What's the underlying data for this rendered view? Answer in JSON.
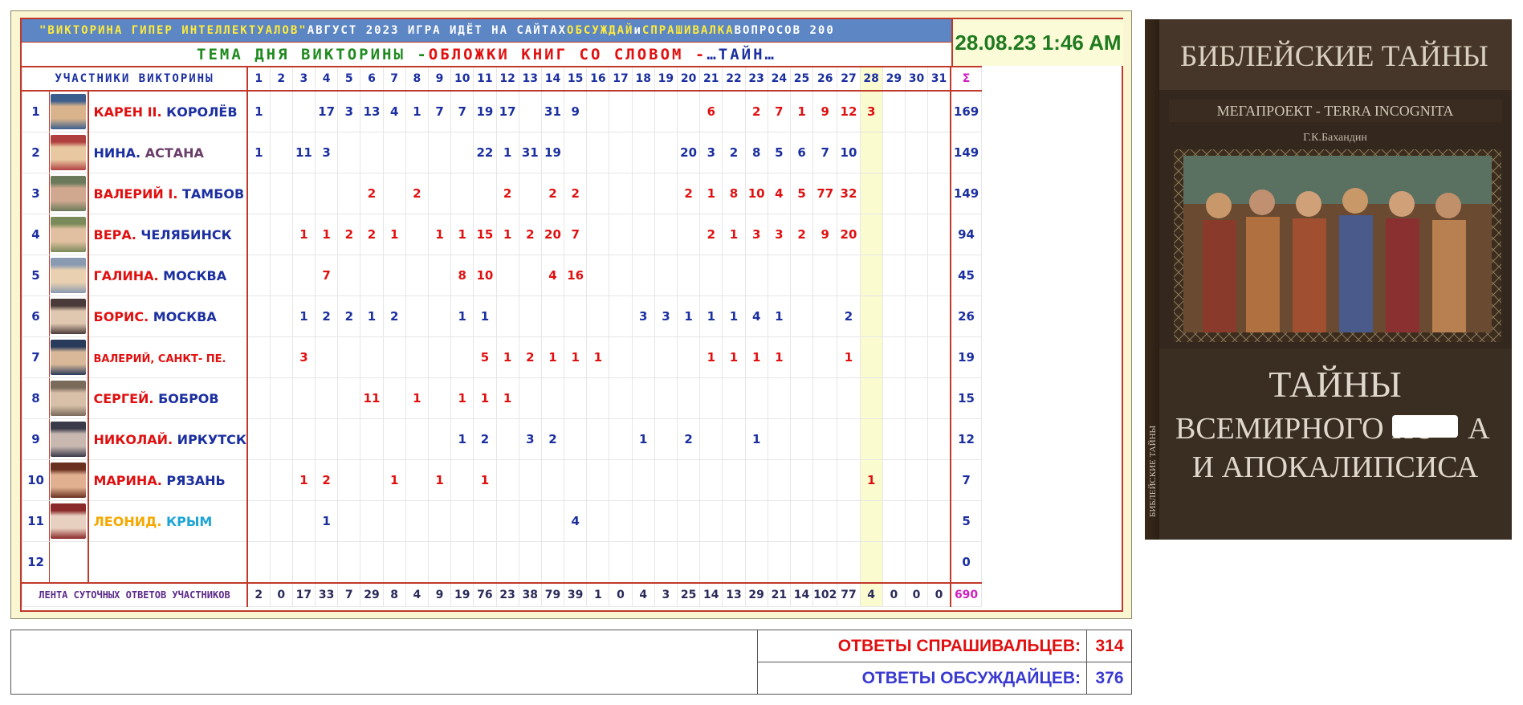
{
  "header": {
    "banner": [
      {
        "text": "\"ВИКТОРИНА ГИПЕР ИНТЕЛЛЕКТУАЛОВ\"",
        "color": "#ffeb3b"
      },
      {
        "text": " АВГУСТ 2023 ИГРА ИДЁТ НА САЙТАХ ",
        "color": "#ffffff"
      },
      {
        "text": "ОБСУЖДАЙ",
        "color": "#ffeb3b"
      },
      {
        "text": " и ",
        "color": "#ffffff"
      },
      {
        "text": "СПРАШИВАЛКА",
        "color": "#ffeb3b"
      },
      {
        "text": " ВОПРОСОВ 200",
        "color": "#ffffff"
      }
    ],
    "theme": [
      {
        "text": "ТЕМА ДНЯ ВИКТОРИНЫ - ",
        "cls": "g"
      },
      {
        "text": "ОБЛОЖКИ КНИГ СО СЛОВОМ - ",
        "cls": "r"
      },
      {
        "text": "…ТАЙН…",
        "cls": "b"
      }
    ],
    "datetime": "28.08.23 1:46 AM"
  },
  "table": {
    "participants_title": "УЧАСТНИКИ ВИКТОРИНЫ",
    "days": [
      "1",
      "2",
      "3",
      "4",
      "5",
      "6",
      "7",
      "8",
      "9",
      "10",
      "11",
      "12",
      "13",
      "14",
      "15",
      "16",
      "17",
      "18",
      "19",
      "20",
      "21",
      "22",
      "23",
      "24",
      "25",
      "26",
      "27",
      "28",
      "29",
      "30",
      "31"
    ],
    "red_days": [
      "6",
      "13",
      "20",
      "27"
    ],
    "sum_symbol": "Σ",
    "rows": [
      {
        "num": "1",
        "name_parts": [
          {
            "t": "КАРЕН II.",
            "c": "nr"
          },
          {
            "t": " КОРОЛЁВ",
            "c": "nb"
          }
        ],
        "avatar": [
          "#3b5e8c",
          "#d9b38c"
        ],
        "cells": {
          "1": [
            "1",
            "b"
          ],
          "4": [
            "17",
            "b"
          ],
          "5": [
            "3",
            "b"
          ],
          "6": [
            "13",
            "b"
          ],
          "7": [
            "4",
            "b"
          ],
          "8": [
            "1",
            "b"
          ],
          "9": [
            "7",
            "b"
          ],
          "10": [
            "7",
            "b"
          ],
          "11": [
            "19",
            "b"
          ],
          "12": [
            "17",
            "b"
          ],
          "14": [
            "31",
            "b"
          ],
          "15": [
            "9",
            "b"
          ],
          "21": [
            "6",
            "r"
          ],
          "23": [
            "2",
            "r"
          ],
          "24": [
            "7",
            "r"
          ],
          "25": [
            "1",
            "r"
          ],
          "26": [
            "9",
            "r"
          ],
          "27": [
            "12",
            "r"
          ],
          "28": [
            "3",
            "r"
          ]
        },
        "sum": "169"
      },
      {
        "num": "2",
        "name_parts": [
          {
            "t": "НИНА.",
            "c": "nb"
          },
          {
            "t": " АСТАНА",
            "c": "nm"
          }
        ],
        "avatar": [
          "#b04040",
          "#e8c8a0"
        ],
        "cells": {
          "1": [
            "1",
            "b"
          ],
          "3": [
            "11",
            "b"
          ],
          "4": [
            "3",
            "b"
          ],
          "11": [
            "22",
            "b"
          ],
          "12": [
            "1",
            "b"
          ],
          "13": [
            "31",
            "b"
          ],
          "14": [
            "19",
            "b"
          ],
          "20": [
            "20",
            "b"
          ],
          "21": [
            "3",
            "b"
          ],
          "22": [
            "2",
            "b"
          ],
          "23": [
            "8",
            "b"
          ],
          "24": [
            "5",
            "b"
          ],
          "25": [
            "6",
            "b"
          ],
          "26": [
            "7",
            "b"
          ],
          "27": [
            "10",
            "b"
          ]
        },
        "sum": "149"
      },
      {
        "num": "3",
        "name_parts": [
          {
            "t": "ВАЛЕРИЙ I.",
            "c": "nr"
          },
          {
            "t": "  ТАМБОВ",
            "c": "nb"
          }
        ],
        "avatar": [
          "#6a7a5a",
          "#d0a890"
        ],
        "cells": {
          "6": [
            "2",
            "r"
          ],
          "8": [
            "2",
            "r"
          ],
          "12": [
            "2",
            "r"
          ],
          "14": [
            "2",
            "r"
          ],
          "15": [
            "2",
            "r"
          ],
          "20": [
            "2",
            "r"
          ],
          "21": [
            "1",
            "r"
          ],
          "22": [
            "8",
            "r"
          ],
          "23": [
            "10",
            "r"
          ],
          "24": [
            "4",
            "r"
          ],
          "25": [
            "5",
            "r"
          ],
          "26": [
            "77",
            "r"
          ],
          "27": [
            "32",
            "r"
          ]
        },
        "sum": "149"
      },
      {
        "num": "4",
        "name_parts": [
          {
            "t": "ВЕРА.",
            "c": "nr"
          },
          {
            "t": " ЧЕЛЯБИНСК",
            "c": "nb"
          }
        ],
        "avatar": [
          "#7a8a5a",
          "#e0c0a0"
        ],
        "cells": {
          "3": [
            "1",
            "r"
          ],
          "4": [
            "1",
            "r"
          ],
          "5": [
            "2",
            "r"
          ],
          "6": [
            "2",
            "r"
          ],
          "7": [
            "1",
            "r"
          ],
          "9": [
            "1",
            "r"
          ],
          "10": [
            "1",
            "r"
          ],
          "11": [
            "15",
            "r"
          ],
          "12": [
            "1",
            "r"
          ],
          "13": [
            "2",
            "r"
          ],
          "14": [
            "20",
            "r"
          ],
          "15": [
            "7",
            "r"
          ],
          "21": [
            "2",
            "r"
          ],
          "22": [
            "1",
            "r"
          ],
          "23": [
            "3",
            "r"
          ],
          "24": [
            "3",
            "r"
          ],
          "25": [
            "2",
            "r"
          ],
          "26": [
            "9",
            "r"
          ],
          "27": [
            "20",
            "r"
          ]
        },
        "sum": "94"
      },
      {
        "num": "5",
        "name_parts": [
          {
            "t": "ГАЛИНА.",
            "c": "nr"
          },
          {
            "t": " МОСКВА",
            "c": "nb"
          }
        ],
        "avatar": [
          "#8a9ab0",
          "#e8d0b0"
        ],
        "cells": {
          "4": [
            "7",
            "r"
          ],
          "10": [
            "8",
            "r"
          ],
          "11": [
            "10",
            "r"
          ],
          "14": [
            "4",
            "r"
          ],
          "15": [
            "16",
            "r"
          ]
        },
        "sum": "45"
      },
      {
        "num": "6",
        "name_parts": [
          {
            "t": "БОРИС.",
            "c": "nr"
          },
          {
            "t": " МОСКВА",
            "c": "nb"
          }
        ],
        "avatar": [
          "#4a3a3a",
          "#e0c8b0"
        ],
        "cells": {
          "3": [
            "1",
            "b"
          ],
          "4": [
            "2",
            "b"
          ],
          "5": [
            "2",
            "b"
          ],
          "6": [
            "1",
            "b"
          ],
          "7": [
            "2",
            "b"
          ],
          "10": [
            "1",
            "b"
          ],
          "11": [
            "1",
            "b"
          ],
          "18": [
            "3",
            "b"
          ],
          "19": [
            "3",
            "b"
          ],
          "20": [
            "1",
            "b"
          ],
          "21": [
            "1",
            "b"
          ],
          "22": [
            "1",
            "b"
          ],
          "23": [
            "4",
            "b"
          ],
          "24": [
            "1",
            "b"
          ],
          "27": [
            "2",
            "b"
          ]
        },
        "sum": "26"
      },
      {
        "num": "7",
        "name_parts": [
          {
            "t": "ВАЛЕРИЙ, САНКТ- ПЕ.",
            "c": "nr",
            "small": true
          }
        ],
        "avatar": [
          "#2a3a5a",
          "#d8b898"
        ],
        "cells": {
          "3": [
            "3",
            "r"
          ],
          "11": [
            "5",
            "r"
          ],
          "12": [
            "1",
            "r"
          ],
          "13": [
            "2",
            "r"
          ],
          "14": [
            "1",
            "r"
          ],
          "15": [
            "1",
            "r"
          ],
          "16": [
            "1",
            "r"
          ],
          "21": [
            "1",
            "r"
          ],
          "22": [
            "1",
            "r"
          ],
          "23": [
            "1",
            "r"
          ],
          "24": [
            "1",
            "r"
          ],
          "27": [
            "1",
            "r"
          ]
        },
        "sum": "19"
      },
      {
        "num": "8",
        "name_parts": [
          {
            "t": "СЕРГЕЙ.",
            "c": "nr"
          },
          {
            "t": " БОБРОВ",
            "c": "nb"
          }
        ],
        "avatar": [
          "#7a6a5a",
          "#d8c0a8"
        ],
        "cells": {
          "6": [
            "11",
            "r"
          ],
          "8": [
            "1",
            "r"
          ],
          "10": [
            "1",
            "r"
          ],
          "11": [
            "1",
            "r"
          ],
          "12": [
            "1",
            "r"
          ]
        },
        "sum": "15"
      },
      {
        "num": "9",
        "name_parts": [
          {
            "t": "НИКОЛАЙ.",
            "c": "nr"
          },
          {
            "t": " ИРКУТСК",
            "c": "nb"
          }
        ],
        "avatar": [
          "#3a3a4a",
          "#c8b8b0"
        ],
        "cells": {
          "10": [
            "1",
            "b"
          ],
          "11": [
            "2",
            "b"
          ],
          "13": [
            "3",
            "b"
          ],
          "14": [
            "2",
            "b"
          ],
          "18": [
            "1",
            "b"
          ],
          "20": [
            "2",
            "b"
          ],
          "23": [
            "1",
            "b"
          ]
        },
        "sum": "12"
      },
      {
        "num": "10",
        "name_parts": [
          {
            "t": "МАРИНА.",
            "c": "nr"
          },
          {
            "t": " РЯЗАНЬ",
            "c": "nb"
          }
        ],
        "avatar": [
          "#6a3020",
          "#e0b090"
        ],
        "cells": {
          "3": [
            "1",
            "r"
          ],
          "4": [
            "2",
            "r"
          ],
          "7": [
            "1",
            "r"
          ],
          "9": [
            "1",
            "r"
          ],
          "11": [
            "1",
            "r"
          ],
          "28": [
            "1",
            "r"
          ]
        },
        "sum": "7"
      },
      {
        "num": "11",
        "name_parts": [
          {
            "t": " ЛЕОНИД.",
            "c": "no"
          },
          {
            "t": " КРЫМ",
            "c": "nc"
          }
        ],
        "avatar": [
          "#8a2a2a",
          "#e8d0c0"
        ],
        "cells": {
          "4": [
            "1",
            "b"
          ],
          "15": [
            "4",
            "b"
          ]
        },
        "sum": "5"
      },
      {
        "num": "12",
        "name_parts": [],
        "avatar": null,
        "cells": {},
        "sum": "0"
      }
    ],
    "totals_title": "ЛЕНТА СУТОЧНЫХ ОТВЕТОВ УЧАСТНИКОВ",
    "totals": [
      "2",
      "0",
      "17",
      "33",
      "7",
      "29",
      "8",
      "4",
      "9",
      "19",
      "76",
      "23",
      "38",
      "79",
      "39",
      "1",
      "0",
      "4",
      "3",
      "25",
      "14",
      "13",
      "29",
      "21",
      "14",
      "102",
      "77",
      "4",
      "0",
      "0",
      "0"
    ],
    "grand_total": "690"
  },
  "summary": {
    "askers_label": "ОТВЕТЫ СПРАШИВАЛЬЦЕВ:",
    "askers_value": "314",
    "askers_color": "#e01010",
    "discussers_label": "ОТВЕТЫ ОБСУЖДАЙЦЕВ:",
    "discussers_value": "376",
    "discussers_color": "#3a3ad0"
  },
  "book": {
    "title_top": "БИБЛЕЙСКИЕ ТАЙНЫ",
    "series": "МЕГАПРОЕКТ - TERRA INCOGNITA",
    "author": "Г.К.Бахандин",
    "title_line1": "ТАЙНЫ",
    "title_line2": "ВСЕМИРНОГО ПО",
    "title_line2_tail": "А",
    "title_line3": "И АПОКАЛИПСИСА",
    "spine": "БИБЛЕЙСКИЕ ТАЙНЫ"
  }
}
